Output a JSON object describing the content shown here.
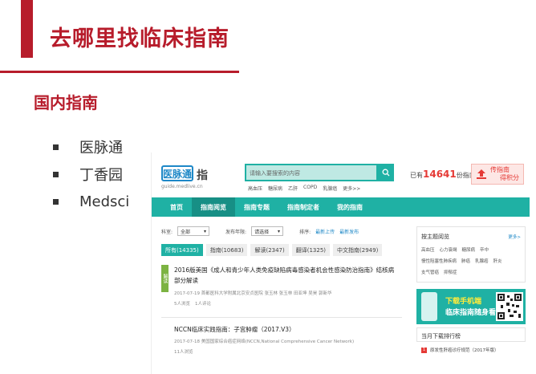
{
  "slide": {
    "title": "去哪里找临床指南",
    "subtitle": "国内指南",
    "bullets": [
      "医脉通",
      "丁香园",
      "Medsci"
    ]
  },
  "site": {
    "logo": {
      "brand": "医脉通",
      "zhi": "指",
      "url": "guide.medlive.cn"
    },
    "search": {
      "placeholder": "请输入要搜索的内容",
      "icon": "search-icon"
    },
    "hot_links": [
      "高血压",
      "糖尿病",
      "乙肝",
      "COPD",
      "乳腺癌",
      "更多>>"
    ],
    "count": {
      "prefix": "已有",
      "number": "14641",
      "suffix": "份指南"
    },
    "upload": {
      "line1": "传指南",
      "line2": "得积分",
      "icon": "upload-icon"
    },
    "nav": [
      "首页",
      "指南阅览",
      "指南专题",
      "指南制定者",
      "我的指南"
    ],
    "nav_active": 1,
    "filters": {
      "subject_label": "科室:",
      "subject_value": "全部",
      "year_label": "发布年限:",
      "year_value": "请选择",
      "sort_label": "排序:",
      "sort_newest": "最新上传",
      "sort_latest": "最新发布"
    },
    "tabs": [
      "所有(14335)",
      "指南(10683)",
      "解读(2347)",
      "翻译(1325)",
      "中文指南(2949)"
    ],
    "entries": [
      {
        "tag": "解读",
        "title": "2016版美国《成人和青少年人类免疫缺陷病毒感染者机会性感染防治指南》结核病部分解读",
        "meta": "2017-07-19 首都医科大学附属北京安贞医院 张玉林 张玉林 田亚坤 吴昊 郭新华",
        "reads": "5人浏览",
        "comments": "1人评论"
      },
      {
        "title": "NCCN临床实践指南：子宫肿瘤（2017.V3）",
        "meta": "2017-07-18 美国国家综合癌症网络(NCCN,National Comprehensive Cancer Network)",
        "reads": "11人浏览"
      }
    ],
    "sidebar": {
      "theme_head": "按主题阅览",
      "more": "更多>",
      "theme_rows": [
        [
          "高血压",
          "心力衰竭",
          "糖尿病",
          "卒中"
        ],
        [
          "慢性阻塞性肺疾病",
          "肺癌",
          "乳腺癌",
          "肝炎"
        ],
        [
          "支气管癌",
          "抑郁症"
        ]
      ],
      "app_line1": "下载手机端",
      "app_line2": "临床指南随身看",
      "rank_head": "当月下载排行榜",
      "rank_items": [
        {
          "rank": "1",
          "text": "原发性肝癌诊疗规范（2017年版）"
        }
      ]
    }
  },
  "colors": {
    "accent": "#b71c2b",
    "site_teal": "#1fb1a4",
    "count_red": "#e53935"
  }
}
